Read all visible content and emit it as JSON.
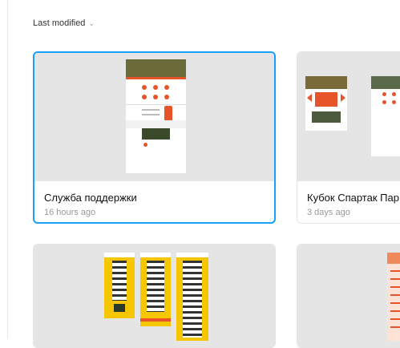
{
  "sort": {
    "label": "Last modified"
  },
  "files": [
    {
      "title": "Служба поддержки",
      "time": "16 hours ago"
    },
    {
      "title": "Кубок Спартак Пар",
      "time": "3 days ago"
    },
    {
      "title": "",
      "time": ""
    },
    {
      "title": "",
      "time": ""
    }
  ],
  "colors": {
    "selection": "#18a0fb",
    "thumb_bg": "#e5e5e5",
    "accent_orange": "#e8542a",
    "accent_yellow": "#f6c700"
  }
}
